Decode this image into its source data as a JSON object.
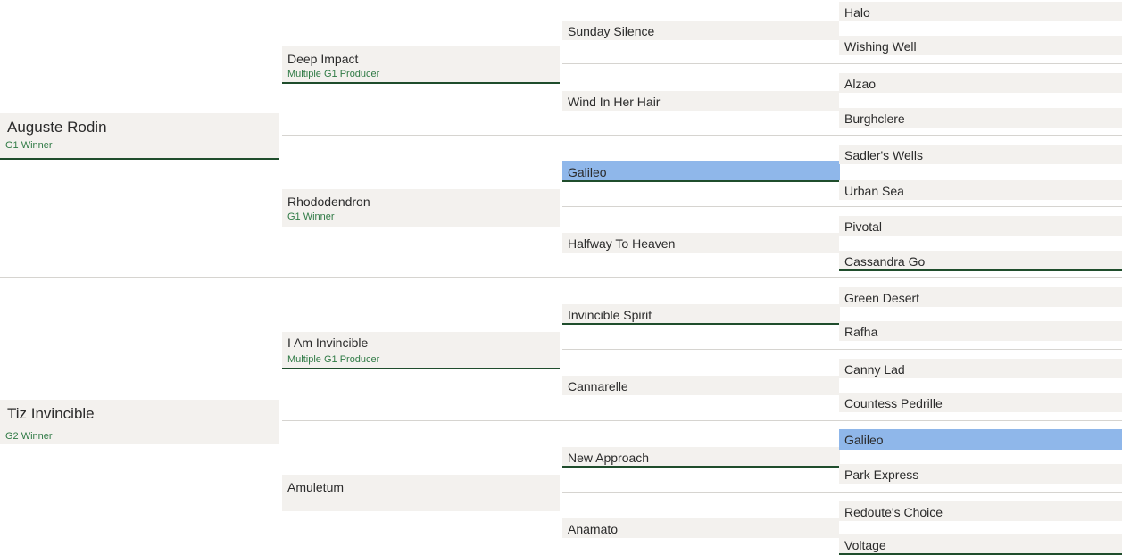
{
  "pedigree": {
    "gen0": [
      {
        "name": "Auguste Rodin",
        "sub": "G1 Winner"
      },
      {
        "name": "Tiz Invincible",
        "sub": "G2 Winner"
      }
    ],
    "gen1": [
      {
        "name": "Deep Impact",
        "sub": "Multiple G1 Producer"
      },
      {
        "name": "Rhododendron",
        "sub": "G1 Winner"
      },
      {
        "name": "I Am Invincible",
        "sub": "Multiple G1 Producer"
      },
      {
        "name": "Amuletum",
        "sub": ""
      }
    ],
    "gen2": [
      {
        "name": "Sunday Silence"
      },
      {
        "name": "Wind In Her Hair"
      },
      {
        "name": "Galileo",
        "highlight": true
      },
      {
        "name": "Halfway To Heaven"
      },
      {
        "name": "Invincible Spirit"
      },
      {
        "name": "Cannarelle"
      },
      {
        "name": "New Approach"
      },
      {
        "name": "Anamato"
      }
    ],
    "gen3": [
      {
        "name": "Halo"
      },
      {
        "name": "Wishing Well"
      },
      {
        "name": "Alzao"
      },
      {
        "name": "Burghclere"
      },
      {
        "name": "Sadler's Wells"
      },
      {
        "name": "Urban Sea"
      },
      {
        "name": "Pivotal"
      },
      {
        "name": "Cassandra Go"
      },
      {
        "name": "Green Desert"
      },
      {
        "name": "Rafha"
      },
      {
        "name": "Canny Lad"
      },
      {
        "name": "Countess Pedrille"
      },
      {
        "name": "Galileo",
        "highlight": true
      },
      {
        "name": "Park Express"
      },
      {
        "name": "Redoute's Choice"
      },
      {
        "name": "Voltage"
      }
    ]
  },
  "colors": {
    "box": "#f3f1ee",
    "highlight": "#8fb7ea",
    "underline": "#1f4d2c",
    "subtext": "#2f7a45"
  }
}
